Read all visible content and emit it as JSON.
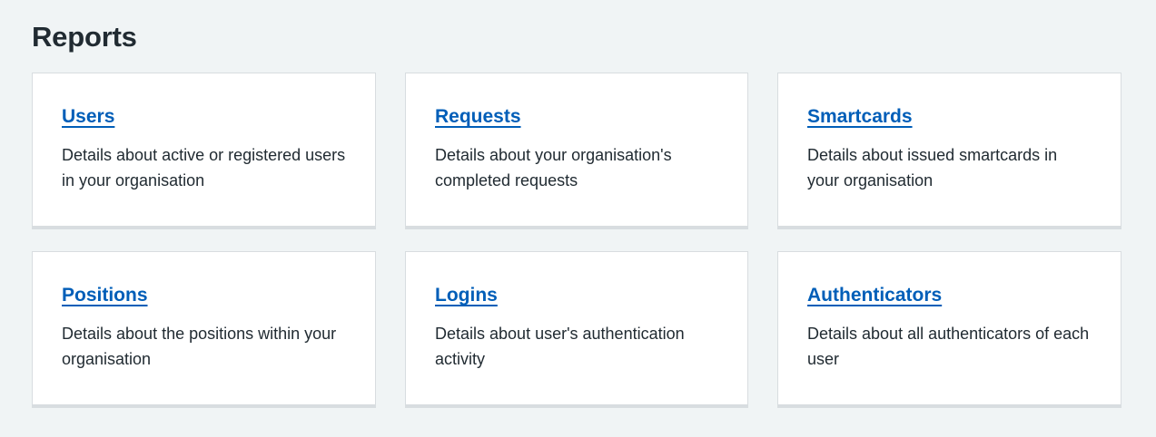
{
  "page": {
    "title": "Reports"
  },
  "cards": [
    {
      "title": "Users",
      "description": "Details about active or registered users in your organisation"
    },
    {
      "title": "Requests",
      "description": "Details about your organisation's completed requests"
    },
    {
      "title": "Smartcards",
      "description": "Details about issued smartcards in your organisation"
    },
    {
      "title": "Positions",
      "description": "Details about the positions within your organisation"
    },
    {
      "title": "Logins",
      "description": "Details about user's authentication activity"
    },
    {
      "title": "Authenticators",
      "description": "Details about all authenticators of each user"
    }
  ],
  "colors": {
    "background": "#f0f4f5",
    "link": "#005eb8",
    "text": "#212b32",
    "card_border": "#d8dde0"
  }
}
